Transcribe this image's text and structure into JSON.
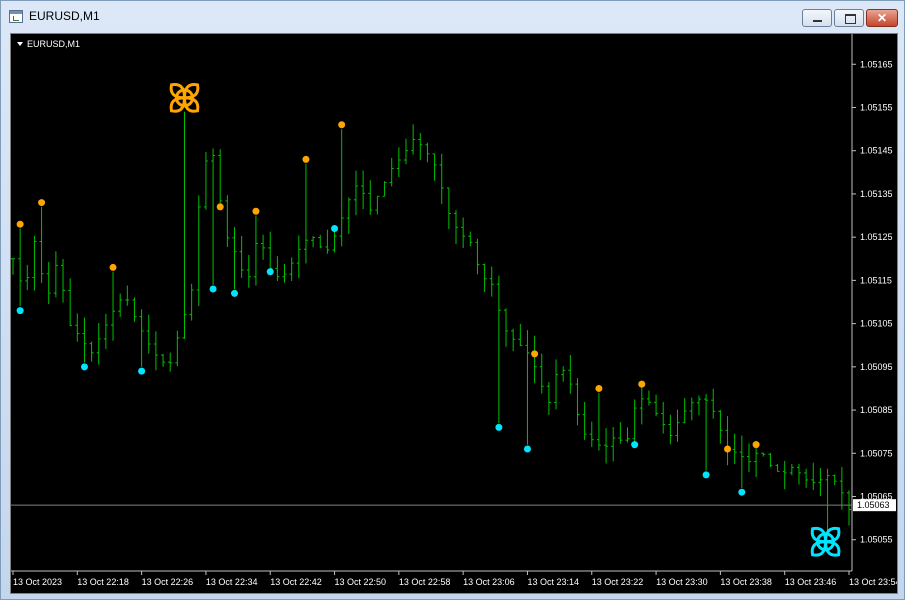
{
  "window": {
    "title": "EURUSD,M1",
    "icon": "chart-window-icon",
    "controls": {
      "minimize_icon": "minimize-icon",
      "maximize_icon": "maximize-icon",
      "close_icon": "close-icon",
      "close_glyph": "✕"
    }
  },
  "chart": {
    "symbol_label": "EURUSD,M1",
    "symbol_menu_icon": "triangle-down-icon",
    "current_price_label": "1.05063",
    "colors": {
      "background": "#000000",
      "candles": "#00c000",
      "grid_text": "#ffffff",
      "top_marker": "#ffa500",
      "bottom_marker": "#00e5ff",
      "price_line": "#808080"
    }
  },
  "chart_data": {
    "type": "ohlc",
    "y_tick_labels": [
      "1.05165",
      "1.05155",
      "1.05145",
      "1.05135",
      "1.05125",
      "1.05115",
      "1.05105",
      "1.05095",
      "1.05085",
      "1.05075",
      "1.05065",
      "1.05055"
    ],
    "x_tick_labels": [
      "13 Oct 2023",
      "13 Oct 22:18",
      "13 Oct 22:26",
      "13 Oct 22:34",
      "13 Oct 22:42",
      "13 Oct 22:50",
      "13 Oct 22:58",
      "13 Oct 23:06",
      "13 Oct 23:14",
      "13 Oct 23:22",
      "13 Oct 23:30",
      "13 Oct 23:38",
      "13 Oct 23:46",
      "13 Oct 23:54"
    ],
    "ylim": [
      1.05048,
      1.05172
    ],
    "current_price": 1.05063,
    "close_path": [
      1.0512,
      1.05112,
      1.05125,
      1.0511,
      1.0512,
      1.05105,
      1.05102,
      1.05098,
      1.05103,
      1.05108,
      1.05112,
      1.05106,
      1.05101,
      1.05097,
      1.05095,
      1.05104,
      1.05112,
      1.05142,
      1.05144,
      1.05126,
      1.05121,
      1.05114,
      1.05126,
      1.05118,
      1.05115,
      1.05119,
      1.05124,
      1.05125,
      1.05121,
      1.05126,
      1.05133,
      1.05138,
      1.05131,
      1.05136,
      1.05141,
      1.05144,
      1.05148,
      1.05145,
      1.05141,
      1.05131,
      1.05126,
      1.05124,
      1.05116,
      1.05114,
      1.05104,
      1.05101,
      1.05099,
      1.05094,
      1.05086,
      1.05096,
      1.05091,
      1.0508,
      1.05078,
      1.05076,
      1.05079,
      1.05077,
      1.05088,
      1.05087,
      1.05083,
      1.05079,
      1.05084,
      1.05087,
      1.05088,
      1.05084,
      1.05076,
      1.05075,
      1.05073,
      1.05076,
      1.05072,
      1.0507,
      1.05072,
      1.05069,
      1.05068,
      1.0507,
      1.05068,
      1.05062
    ],
    "tops": [
      {
        "i": 1,
        "p": 1.05128
      },
      {
        "i": 4,
        "p": 1.05133
      },
      {
        "i": 14,
        "p": 1.05118
      },
      {
        "i": 29,
        "p": 1.05132
      },
      {
        "i": 34,
        "p": 1.05131
      },
      {
        "i": 41,
        "p": 1.05143
      },
      {
        "i": 46,
        "p": 1.05151
      },
      {
        "i": 73,
        "p": 1.05098
      },
      {
        "i": 82,
        "p": 1.0509
      },
      {
        "i": 88,
        "p": 1.05091
      },
      {
        "i": 100,
        "p": 1.05076
      },
      {
        "i": 104,
        "p": 1.05077
      }
    ],
    "bottoms": [
      {
        "i": 1,
        "p": 1.05108
      },
      {
        "i": 10,
        "p": 1.05095
      },
      {
        "i": 18,
        "p": 1.05094
      },
      {
        "i": 28,
        "p": 1.05113
      },
      {
        "i": 31,
        "p": 1.05112
      },
      {
        "i": 36,
        "p": 1.05117
      },
      {
        "i": 45,
        "p": 1.05127
      },
      {
        "i": 68,
        "p": 1.05081
      },
      {
        "i": 72,
        "p": 1.05076
      },
      {
        "i": 87,
        "p": 1.05077
      },
      {
        "i": 97,
        "p": 1.0507
      },
      {
        "i": 102,
        "p": 1.05066
      }
    ],
    "big_top": {
      "i": 24,
      "p": 1.05157
    },
    "big_bottom": {
      "i": 114,
      "p": 1.05055
    }
  }
}
